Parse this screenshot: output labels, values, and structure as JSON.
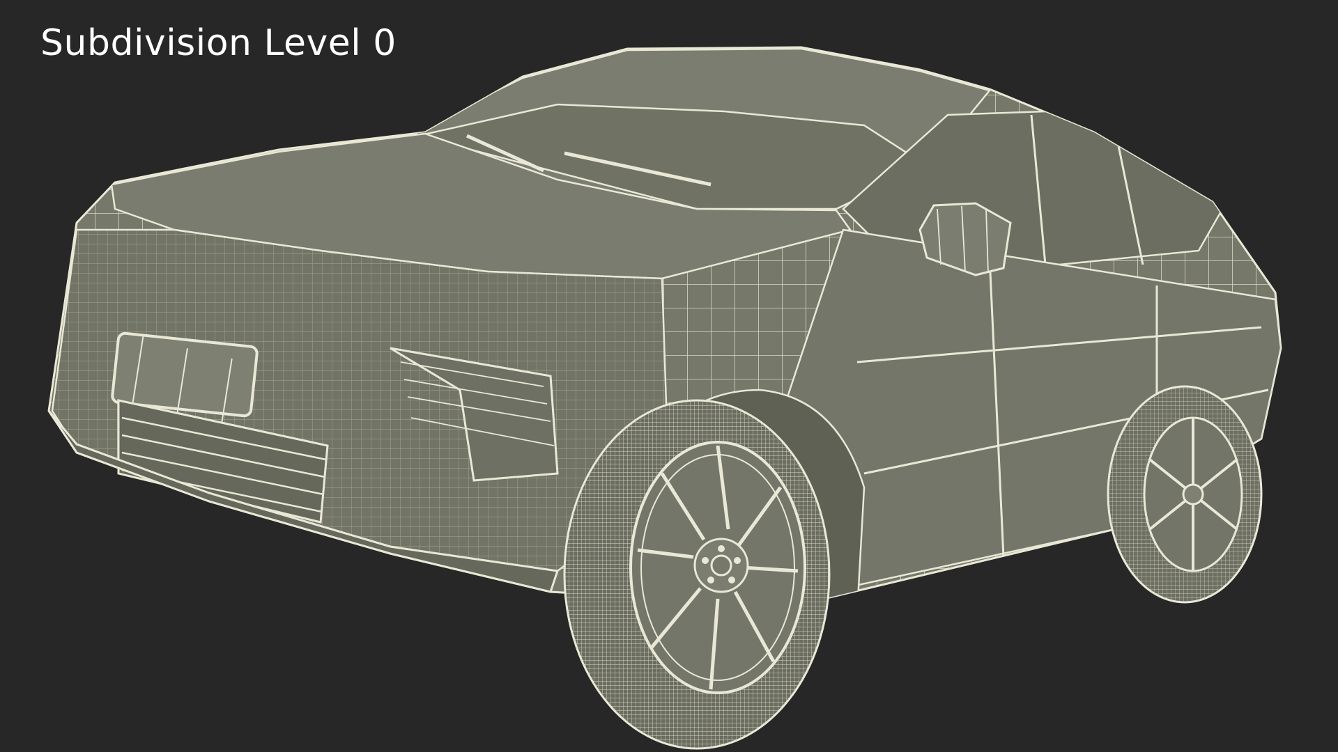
{
  "label": "Subdivision Level 0",
  "colors": {
    "background": "#272727",
    "body": "#76786a",
    "body_dark": "#5f6155",
    "wire": "#e9e8d6",
    "title": "#ffffff"
  },
  "image": {
    "subject": "car-wireframe-render"
  }
}
